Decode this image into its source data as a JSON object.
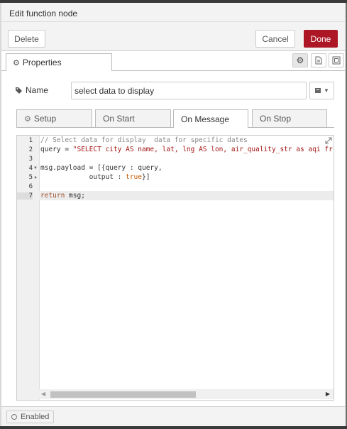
{
  "header": {
    "title": "Edit function node"
  },
  "toolbar": {
    "delete_label": "Delete",
    "cancel_label": "Cancel",
    "done_label": "Done"
  },
  "tabs": {
    "properties_label": "Properties"
  },
  "name_field": {
    "label": "Name",
    "value": "select data to display"
  },
  "subtabs": [
    {
      "label": "Setup"
    },
    {
      "label": "On Start"
    },
    {
      "label": "On Message"
    },
    {
      "label": "On Stop"
    }
  ],
  "editor": {
    "line_numbers": [
      "1",
      "2",
      "3",
      "4",
      "5",
      "6",
      "7"
    ],
    "lines": {
      "l1": "// Select data for display  data for specific dates",
      "l2_a": "query = ",
      "l2_b": "\"SELECT city AS name, lat, lng AS lon, air_quality_str as aqi fr",
      "l4": "msg.payload = [{query : query,",
      "l5_a": "            output : ",
      "l5_b": "true",
      "l5_c": "}]",
      "l7_a": "return",
      "l7_b": " msg;"
    }
  },
  "footer": {
    "enabled_label": "Enabled"
  },
  "colors": {
    "primary": "#ad1625",
    "comment": "#888888",
    "string": "#a31515"
  }
}
